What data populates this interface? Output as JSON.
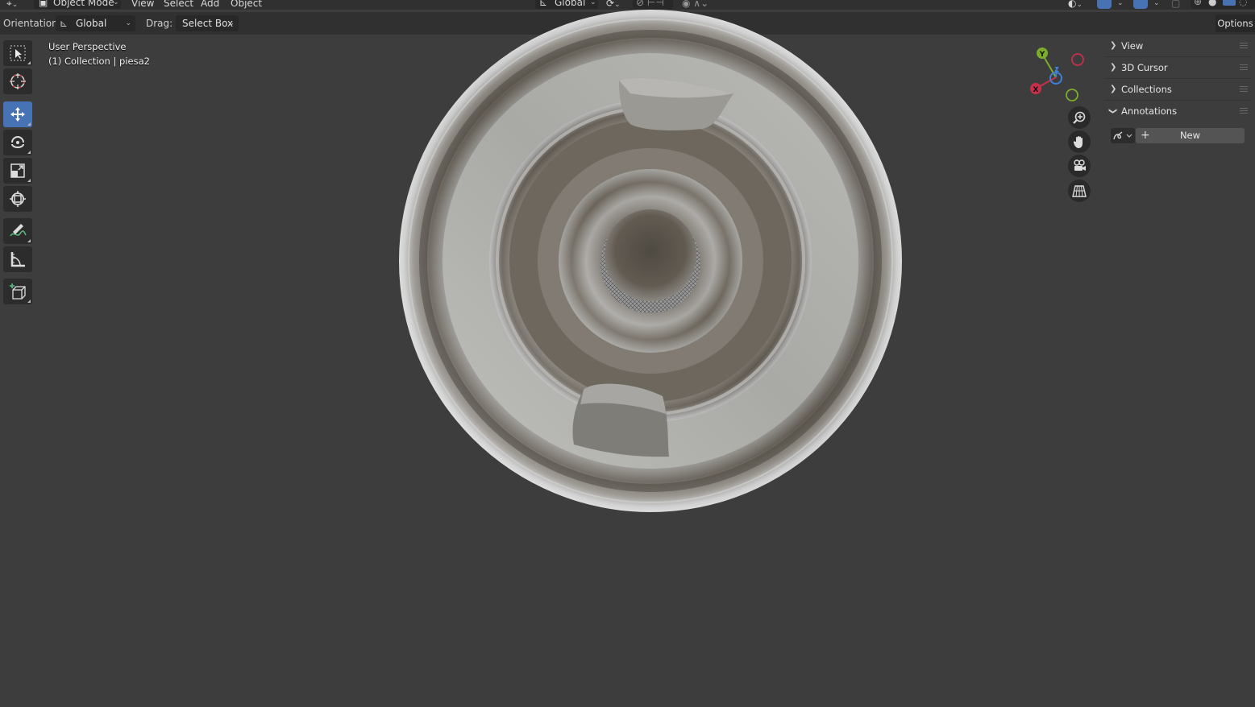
{
  "header": {
    "mode_label": "Object Mode",
    "menus": [
      "View",
      "Select",
      "Add",
      "Object"
    ],
    "transform_orientation": "Global"
  },
  "tool_settings": {
    "orientation_label": "Orientation:",
    "orientation_value": "Global",
    "drag_label": "Drag:",
    "drag_value": "Select Box",
    "options_label": "Options"
  },
  "viewport": {
    "view_name": "User Perspective",
    "collection_info": "(1) Collection | piesa2"
  },
  "gizmo": {
    "x": "X",
    "y": "Y",
    "z": "Z"
  },
  "sidebar": {
    "panels": [
      {
        "label": "View",
        "expanded": false
      },
      {
        "label": "3D Cursor",
        "expanded": false
      },
      {
        "label": "Collections",
        "expanded": false
      },
      {
        "label": "Annotations",
        "expanded": true
      }
    ],
    "annotations_new_label": "New"
  },
  "tools": [
    "select-box",
    "cursor",
    "move",
    "rotate",
    "scale",
    "transform",
    "annotate",
    "measure",
    "add-cube"
  ],
  "colors": {
    "background": "#3d3d3d",
    "header": "#303030",
    "active_tool": "#4772b3",
    "axis_x": "#c7304a",
    "axis_y": "#7cad2c",
    "axis_z": "#3f7fd6"
  }
}
